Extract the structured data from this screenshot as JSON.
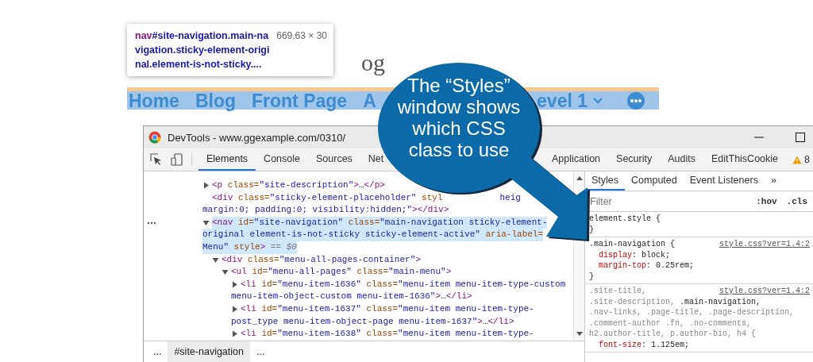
{
  "page": {
    "site_title_fragment": "og",
    "nav_items": [
      {
        "label": "Home",
        "dropdown": false
      },
      {
        "label": "Blog",
        "dropdown": false
      },
      {
        "label": "Front Page",
        "dropdown": false
      },
      {
        "label": "A",
        "dropdown": false
      },
      {
        "label": "evel 1",
        "dropdown": true
      }
    ]
  },
  "tooltip": {
    "tag": "nav",
    "selector": "#site-navigation.main-navigation.sticky-element-original.element-is-not-sticky....",
    "size": "669.63 × 30"
  },
  "devtools": {
    "title": "DevTools - www.ggexample.com/0310/",
    "tabs": [
      {
        "label": "Elements",
        "selected": true
      },
      {
        "label": "Console",
        "selected": false
      },
      {
        "label": "Sources",
        "selected": false
      },
      {
        "label": "Net",
        "selected": false
      },
      {
        "label": "Application",
        "selected": false
      },
      {
        "label": "Security",
        "selected": false
      },
      {
        "label": "Audits",
        "selected": false
      },
      {
        "label": "EditThisCookie",
        "selected": false
      }
    ],
    "warning_count": "8",
    "elements": [
      {
        "kind": "parent",
        "expanded": false,
        "selected": false,
        "lines": [
          {
            "segments": [
              {
                "kind": "tag",
                "text": "<p"
              },
              {
                "kind": "attr",
                "text": " class="
              },
              {
                "kind": "value",
                "text": "\"site-description\""
              },
              {
                "kind": "tag",
                "text": ">"
              },
              {
                "kind": "text",
                "text": "…"
              },
              {
                "kind": "tag",
                "text": "</p>"
              }
            ]
          }
        ]
      },
      {
        "kind": "leaf",
        "selected": false,
        "lines": [
          {
            "segments": [
              {
                "kind": "tag",
                "text": "<div"
              },
              {
                "kind": "attr",
                "text": " class="
              },
              {
                "kind": "value",
                "text": "\"sticky-element-placeholder\""
              },
              {
                "kind": "attr",
                "text": " styl"
              }
            ],
            "tail": [
              {
                "kind": "value",
                "text": "heig"
              }
            ]
          },
          {
            "segments": [
              {
                "kind": "value",
                "text": "margin:0; padding:0; visibility:hidden;\""
              },
              {
                "kind": "tag",
                "text": "></div>"
              }
            ]
          }
        ]
      },
      {
        "kind": "parent",
        "expanded": true,
        "selected": true,
        "lines": [
          {
            "segments": [
              {
                "kind": "tag",
                "text": "<nav"
              },
              {
                "kind": "attr",
                "text": " id="
              },
              {
                "kind": "value",
                "text": "\"site-navigation\""
              },
              {
                "kind": "attr",
                "text": " class="
              },
              {
                "kind": "value",
                "text": "\"main-navigation sticky-element-"
              }
            ]
          },
          {
            "segments": [
              {
                "kind": "value",
                "text": "original element-is-not-sticky sticky-element-active\""
              },
              {
                "kind": "attr",
                "text": " aria-label="
              }
            ]
          },
          {
            "segments": [
              {
                "kind": "value",
                "text": "Menu\""
              },
              {
                "kind": "attr",
                "text": " style"
              },
              {
                "kind": "tag",
                "text": ">"
              },
              {
                "kind": "hint",
                "text": " == $0"
              }
            ]
          }
        ],
        "children": [
          {
            "kind": "parent",
            "expanded": true,
            "selected": false,
            "lines": [
              {
                "segments": [
                  {
                    "kind": "tag",
                    "text": "<div"
                  },
                  {
                    "kind": "attr",
                    "text": " class="
                  },
                  {
                    "kind": "value",
                    "text": "\"menu-all-pages-container\""
                  },
                  {
                    "kind": "tag",
                    "text": ">"
                  }
                ]
              }
            ],
            "children": [
              {
                "kind": "parent",
                "expanded": true,
                "selected": false,
                "lines": [
                  {
                    "segments": [
                      {
                        "kind": "tag",
                        "text": "<ul"
                      },
                      {
                        "kind": "attr",
                        "text": " id="
                      },
                      {
                        "kind": "value",
                        "text": "\"menu-all-pages\""
                      },
                      {
                        "kind": "attr",
                        "text": " class="
                      },
                      {
                        "kind": "value",
                        "text": "\"main-menu\""
                      },
                      {
                        "kind": "tag",
                        "text": ">"
                      }
                    ]
                  }
                ],
                "children": [
                  {
                    "kind": "parent",
                    "expanded": false,
                    "selected": false,
                    "lines": [
                      {
                        "segments": [
                          {
                            "kind": "tag",
                            "text": "<li"
                          },
                          {
                            "kind": "attr",
                            "text": " id="
                          },
                          {
                            "kind": "value",
                            "text": "\"menu-item-1636\""
                          },
                          {
                            "kind": "attr",
                            "text": " class="
                          },
                          {
                            "kind": "value",
                            "text": "\"menu-item menu-item-type-custom"
                          }
                        ]
                      },
                      {
                        "segments": [
                          {
                            "kind": "value",
                            "text": "menu-item-object-custom menu-item-1636\""
                          },
                          {
                            "kind": "tag",
                            "text": ">"
                          },
                          {
                            "kind": "text",
                            "text": "…"
                          },
                          {
                            "kind": "tag",
                            "text": "</li>"
                          }
                        ]
                      }
                    ]
                  },
                  {
                    "kind": "parent",
                    "expanded": false,
                    "selected": false,
                    "lines": [
                      {
                        "segments": [
                          {
                            "kind": "tag",
                            "text": "<li"
                          },
                          {
                            "kind": "attr",
                            "text": " id="
                          },
                          {
                            "kind": "value",
                            "text": "\"menu-item-1637\""
                          },
                          {
                            "kind": "attr",
                            "text": " class="
                          },
                          {
                            "kind": "value",
                            "text": "\"menu-item menu-item-type-"
                          }
                        ]
                      },
                      {
                        "segments": [
                          {
                            "kind": "value",
                            "text": "post_type menu-item-object-page menu-item-1637\""
                          },
                          {
                            "kind": "tag",
                            "text": ">"
                          },
                          {
                            "kind": "text",
                            "text": "…"
                          },
                          {
                            "kind": "tag",
                            "text": "</li>"
                          }
                        ]
                      }
                    ]
                  },
                  {
                    "kind": "parent",
                    "expanded": false,
                    "selected": false,
                    "lines": [
                      {
                        "segments": [
                          {
                            "kind": "tag",
                            "text": "<li"
                          },
                          {
                            "kind": "attr",
                            "text": " id="
                          },
                          {
                            "kind": "value",
                            "text": "\"menu-item-1638\""
                          },
                          {
                            "kind": "attr",
                            "text": " class="
                          },
                          {
                            "kind": "value",
                            "text": "\"menu-item menu-item-type-"
                          }
                        ]
                      }
                    ]
                  }
                ]
              }
            ]
          }
        ]
      }
    ],
    "breadcrumbs": [
      {
        "label": "...",
        "selected": false
      },
      {
        "label": "#site-navigation",
        "selected": true
      },
      {
        "label": "...",
        "selected": false
      }
    ],
    "styles_tabs": [
      {
        "label": "Styles",
        "selected": true
      },
      {
        "label": "Computed",
        "selected": false
      },
      {
        "label": "Event Listeners",
        "selected": false
      }
    ],
    "more_tabs": "»",
    "filter": {
      "placeholder": "Filter"
    },
    "hov": ":hov",
    "cls": ".cls",
    "rules": [
      {
        "selectors": [
          {
            "text": "element.style {",
            "matched": true
          }
        ],
        "close": "}"
      },
      {
        "selectors": [
          {
            "text": ".main-navigation {",
            "matched": true
          }
        ],
        "source": "style.css?ver=1.4:2",
        "properties": [
          {
            "name": "display",
            "value": ": block;"
          },
          {
            "name": "margin-top",
            "value": ": 0.25rem;"
          }
        ],
        "close": "}"
      },
      {
        "selectors": [
          {
            "text": ".site-title,",
            "matched": false
          },
          {
            "text": ".site-description,",
            "matched": false
          },
          {
            "text": ".main-navigation,",
            "matched": true
          },
          {
            "text": ".nav-links,",
            "matched": false
          },
          {
            "text": ".page-title,",
            "matched": false
          },
          {
            "text": ".page-description,",
            "matched": false
          },
          {
            "text": ".comment-author .fn,",
            "matched": false
          },
          {
            "text": ".no-comments,",
            "matched": false
          },
          {
            "text": "h2.author-title,",
            "matched": false
          },
          {
            "text": "p.author-bio,",
            "matched": false
          },
          {
            "text": "h4 {",
            "matched": false
          }
        ],
        "source": "style.css?ver=1.4:2",
        "properties": [
          {
            "name": "font-size",
            "value": ": 1.125em;"
          }
        ]
      }
    ]
  },
  "callout": {
    "text": "The “Styles” window shows which CSS class to use"
  }
}
